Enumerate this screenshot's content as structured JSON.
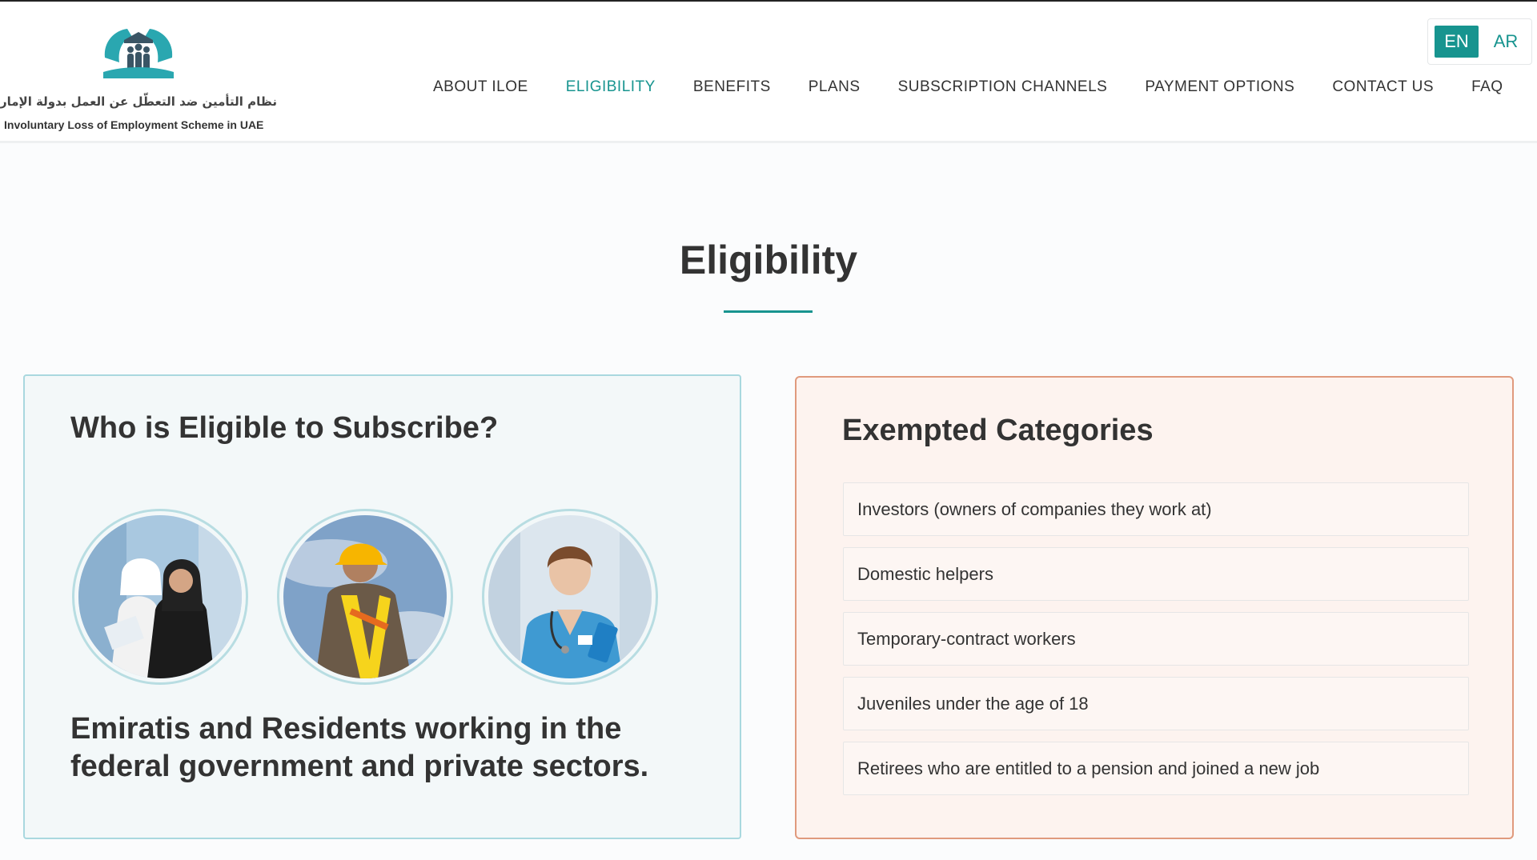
{
  "header": {
    "logo_arabic": "نظام التأمين ضد التعطّل عن العمل بدولة الإمارات",
    "logo_english": "Involuntary Loss of Employment Scheme in UAE",
    "nav": [
      {
        "label": "ABOUT ILOE",
        "active": false
      },
      {
        "label": "ELIGIBILITY",
        "active": true
      },
      {
        "label": "BENEFITS",
        "active": false
      },
      {
        "label": "PLANS",
        "active": false
      },
      {
        "label": "SUBSCRIPTION CHANNELS",
        "active": false
      },
      {
        "label": "PAYMENT OPTIONS",
        "active": false
      },
      {
        "label": "CONTACT US",
        "active": false
      },
      {
        "label": "FAQ",
        "active": false
      }
    ],
    "lang": {
      "en": "EN",
      "ar": "AR",
      "selected": "EN"
    }
  },
  "main": {
    "title": "Eligibility",
    "eligible_card": {
      "heading": "Who is Eligible to Subscribe?",
      "images": [
        "emirati-professionals-photo",
        "construction-worker-photo",
        "nurse-photo"
      ],
      "description": "Emiratis and Residents working in the federal government and private sectors."
    },
    "exempted_card": {
      "heading": "Exempted Categories",
      "items": [
        "Investors (owners of companies they work at)",
        "Domestic helpers",
        "Temporary-contract workers",
        "Juveniles under the age of 18",
        "Retirees who are entitled to a pension and joined a new job"
      ]
    }
  },
  "colors": {
    "accent": "#17948f",
    "eligible_border": "#a9d8df",
    "exempted_border": "#e09a7d",
    "exempted_bg": "#fdf3ef"
  }
}
